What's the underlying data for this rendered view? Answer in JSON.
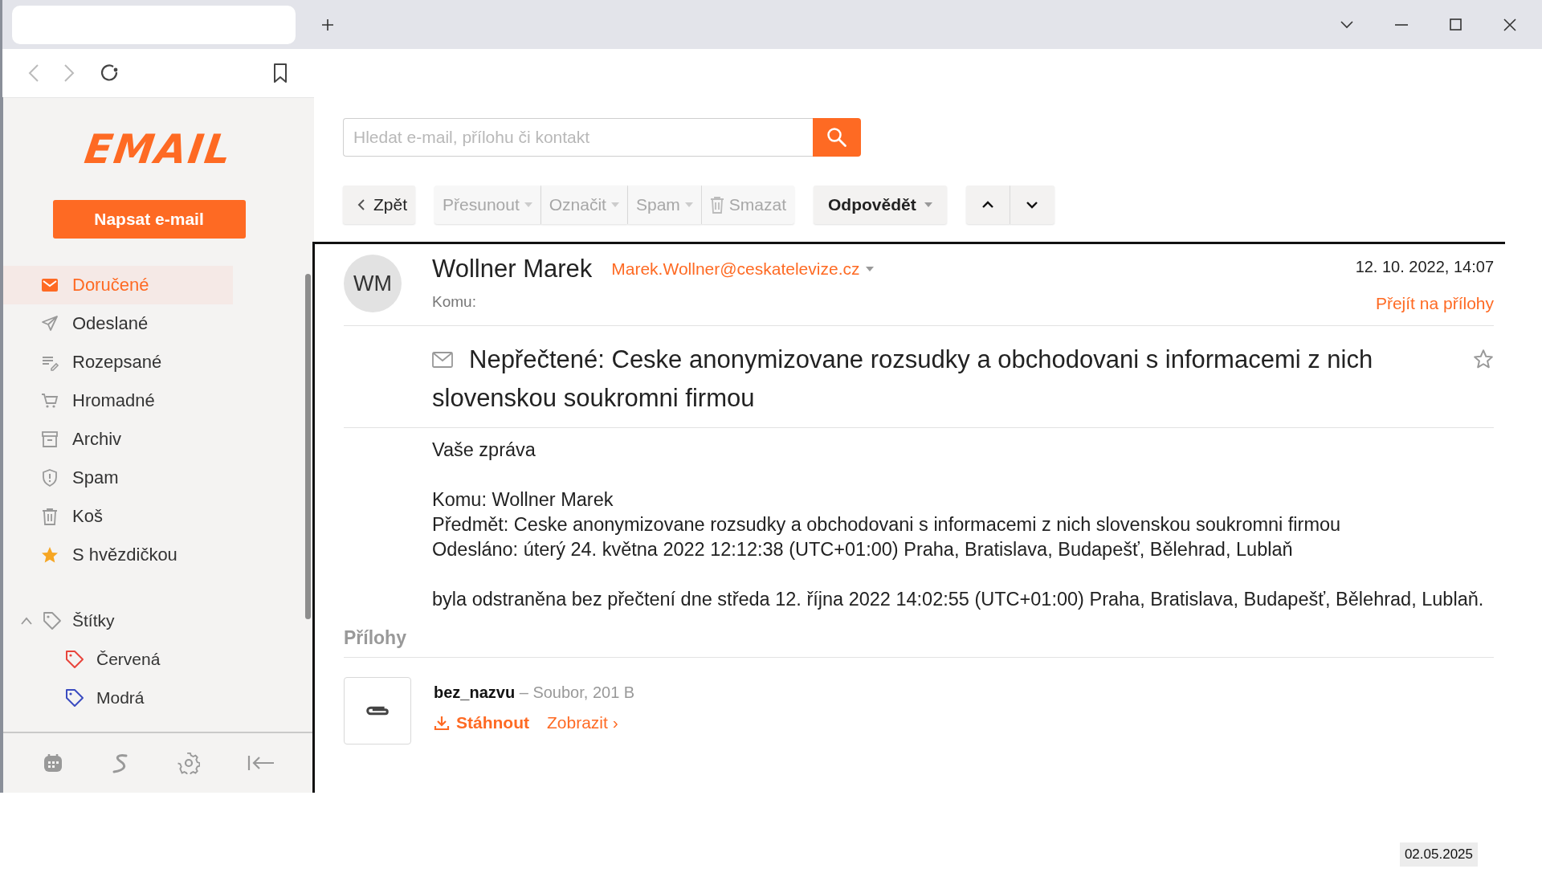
{
  "sidebar": {
    "logo": "EMAIL",
    "compose_button": "Napsat e-mail",
    "folders": [
      {
        "label": "Doručené",
        "selected": true
      },
      {
        "label": "Odeslané",
        "selected": false
      },
      {
        "label": "Rozepsané",
        "selected": false
      },
      {
        "label": "Hromadné",
        "selected": false
      },
      {
        "label": "Archiv",
        "selected": false
      },
      {
        "label": "Spam",
        "selected": false
      },
      {
        "label": "Koš",
        "selected": false
      },
      {
        "label": "S hvězdičkou",
        "selected": false
      }
    ],
    "labels": {
      "title": "Štítky",
      "expanded": true,
      "items": [
        {
          "label": "Červená",
          "color": "#e8453c"
        },
        {
          "label": "Modrá",
          "color": "#3b4cc0"
        }
      ]
    }
  },
  "search": {
    "placeholder": "Hledat e-mail, přílohu či kontakt"
  },
  "toolbar": {
    "back": "Zpět",
    "actions": [
      {
        "label": "Přesunout",
        "kind": "dropdown",
        "disabled": true
      },
      {
        "label": "Označit",
        "kind": "dropdown",
        "disabled": true
      },
      {
        "label": "Spam",
        "kind": "dropdown",
        "disabled": true
      },
      {
        "label": "Smazat",
        "kind": "delete",
        "disabled": true
      }
    ],
    "reply": "Odpovědět"
  },
  "message": {
    "avatar": "WM",
    "sender": "Wollner Marek",
    "email": "Marek.Wollner@ceskatelevize.cz",
    "to_label": "Komu:",
    "date": "12. 10. 2022, 14:07",
    "attachments_link": "Přejít na přílohy",
    "subject": "Nepřečtené: Ceske anonymizovane rozsudky a obchodovani s informacemi z nich slovenskou soukromni firmou",
    "starred": false,
    "body": [
      [
        "Vaše zpráva"
      ],
      [
        "Komu: Wollner Marek",
        "Předmět: Ceske anonymizovane rozsudky a obchodovani s informacemi z nich slovenskou soukromni firmou",
        "Odesláno: úterý 24. května 2022 12:12:38 (UTC+01:00) Praha, Bratislava, Budapešť, Bělehrad, Lublaň"
      ],
      [
        "byla odstraněna bez přečtení dne středa 12. října 2022 14:02:55 (UTC+01:00) Praha, Bratislava, Budapešť, Bělehrad, Lublaň."
      ]
    ]
  },
  "attachments": {
    "title": "Přílohy",
    "items": [
      {
        "name": "bez_nazvu",
        "meta": "– Soubor, 201 B",
        "download": "Stáhnout",
        "view": "Zobrazit ›"
      }
    ]
  },
  "desktop_date": "02.05.2025"
}
